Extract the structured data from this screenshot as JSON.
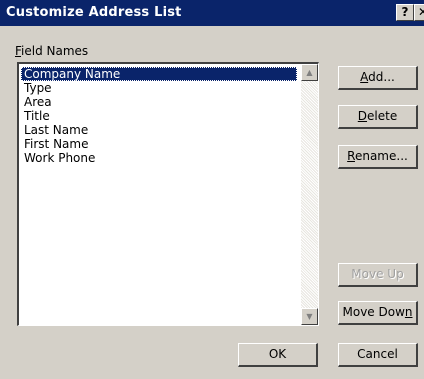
{
  "window": {
    "title": "Customize Address List",
    "help_glyph": "?",
    "close_glyph": "✕"
  },
  "field_names": {
    "label_accel": "F",
    "label_rest": "ield Names",
    "items": [
      "Company Name",
      "Type",
      "Area",
      "Title",
      "Last Name",
      "First Name",
      "Work Phone"
    ],
    "selected_index": 0
  },
  "scrollbar": {
    "up_glyph": "▲",
    "down_glyph": "▼"
  },
  "buttons": {
    "add": {
      "accel": "A",
      "rest": "dd..."
    },
    "delete": {
      "accel": "D",
      "rest": "elete"
    },
    "rename": {
      "accel": "R",
      "rest": "ename..."
    },
    "move_up": "Move Up",
    "move_down": {
      "before": "Move Dow",
      "accel": "n"
    },
    "ok": "OK",
    "cancel": "Cancel"
  },
  "colors": {
    "titlebar": "#0a246a",
    "face": "#d4d0c8",
    "selection": "#0a246a"
  }
}
